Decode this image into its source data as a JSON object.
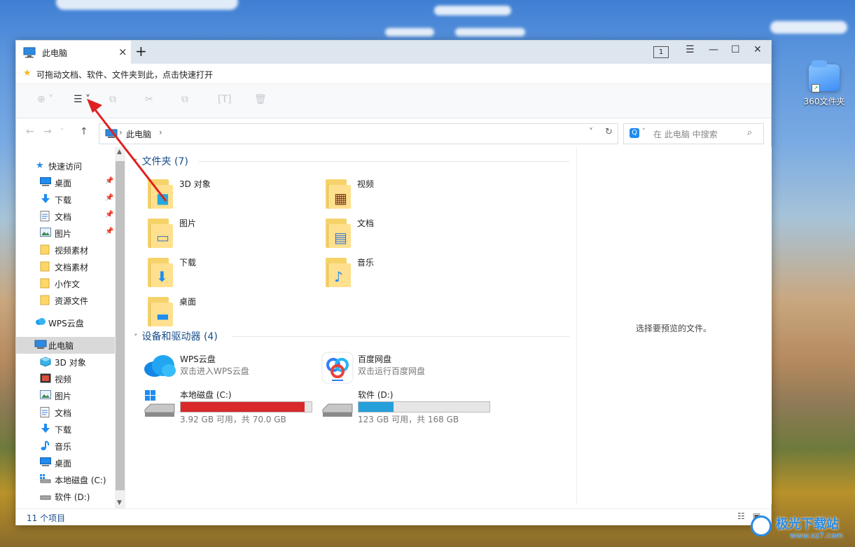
{
  "desktop": {
    "shortcut_label": "360文件夹"
  },
  "window": {
    "tab_title": "此电脑",
    "tab_close": "×",
    "new_tab": "+",
    "window_index": "1",
    "menu_glyph": "☰",
    "minimize_glyph": "—",
    "maximize_glyph": "☐",
    "close_glyph": "✕"
  },
  "favbar": {
    "hint": "可拖动文档、软件、文件夹到此，点击快速打开"
  },
  "address": {
    "crumb": "此电脑",
    "separator": "›",
    "search_placeholder": "在 此电脑 中搜索"
  },
  "sidebar": {
    "quick_access": "快速访问",
    "quick_items": [
      {
        "label": "桌面",
        "icon": "desktop-icon"
      },
      {
        "label": "下载",
        "icon": "download-icon"
      },
      {
        "label": "文档",
        "icon": "document-icon"
      },
      {
        "label": "图片",
        "icon": "picture-icon"
      },
      {
        "label": "视频素材",
        "icon": "folder-icon"
      },
      {
        "label": "文档素材",
        "icon": "folder-icon"
      },
      {
        "label": "小作文",
        "icon": "folder-icon"
      },
      {
        "label": "资源文件",
        "icon": "folder-icon"
      }
    ],
    "wps_cloud": "WPS云盘",
    "this_pc": "此电脑",
    "pc_items": [
      {
        "label": "3D 对象",
        "icon": "3d-object-icon"
      },
      {
        "label": "视频",
        "icon": "video-icon"
      },
      {
        "label": "图片",
        "icon": "picture-icon"
      },
      {
        "label": "文档",
        "icon": "document-icon"
      },
      {
        "label": "下载",
        "icon": "download-icon"
      },
      {
        "label": "音乐",
        "icon": "music-icon"
      },
      {
        "label": "桌面",
        "icon": "desktop-icon"
      },
      {
        "label": "本地磁盘 (C:)",
        "icon": "drive-c-icon"
      },
      {
        "label": "软件 (D:)",
        "icon": "drive-d-icon"
      }
    ]
  },
  "content": {
    "folders_header": "文件夹 (7)",
    "folders": [
      {
        "label": "3D 对象",
        "glyph": "■"
      },
      {
        "label": "视频",
        "glyph": "▦"
      },
      {
        "label": "图片",
        "glyph": "▭"
      },
      {
        "label": "文档",
        "glyph": "▤"
      },
      {
        "label": "下载",
        "glyph": "⬇"
      },
      {
        "label": "音乐",
        "glyph": "♪"
      },
      {
        "label": "桌面",
        "glyph": "▬"
      }
    ],
    "devices_header": "设备和驱动器 (4)",
    "wps_name": "WPS云盘",
    "wps_sub": "双击进入WPS云盘",
    "baidu_name": "百度网盘",
    "baidu_sub": "双击运行百度网盘",
    "drive_c_name": "本地磁盘 (C:)",
    "drive_c_space": "3.92 GB 可用，共 70.0 GB",
    "drive_c_used_fraction": 0.944,
    "drive_d_name": "软件 (D:)",
    "drive_d_space": "123 GB 可用，共 168 GB",
    "drive_d_used_fraction": 0.268
  },
  "preview": {
    "message": "选择要预览的文件。"
  },
  "status": {
    "item_count": "11 个项目"
  },
  "watermark": {
    "main": "极光下载站",
    "sub": "www.xz7.com"
  },
  "colors": {
    "accent": "#1e8cf1",
    "drive_c_bar": "#d9292b",
    "drive_d_bar": "#26a0da",
    "group_header": "#1a4d8a",
    "annotation_arrow": "#e02020"
  }
}
